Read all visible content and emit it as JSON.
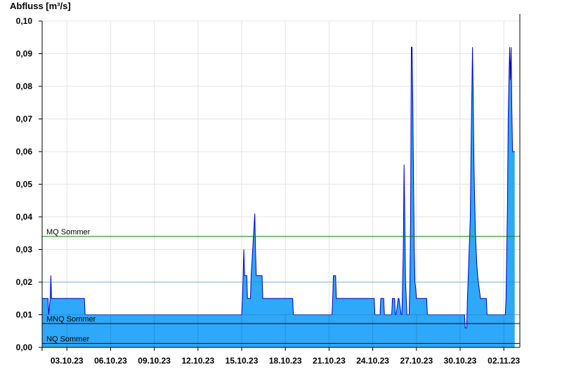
{
  "chart_data": {
    "type": "area",
    "ylabel": "Abfluss [m³/s]",
    "ylim": [
      0,
      0.1
    ],
    "y_ticks": [
      "0,00",
      "0,01",
      "0,02",
      "0,03",
      "0,04",
      "0,05",
      "0,06",
      "0,07",
      "0,08",
      "0,09",
      "0,10"
    ],
    "x_ticks": [
      "03.10.23",
      "06.10.23",
      "09.10.23",
      "12.10.23",
      "15.10.23",
      "18.10.23",
      "21.10.23",
      "24.10.23",
      "27.10.23",
      "30.10.23",
      "02.11.23"
    ],
    "x_tick_days": [
      2,
      5,
      8,
      11,
      14,
      17,
      20,
      23,
      26,
      29,
      32
    ],
    "xlim_days": [
      0.3,
      33.1
    ],
    "x_note": "x values in days since 01.10.23 00:00",
    "grid": true,
    "series": [
      {
        "name": "Abfluss",
        "color_fill": "#2ea8f8",
        "color_line": "#0000c8",
        "x": [
          0.3,
          0.7,
          0.75,
          0.85,
          0.9,
          0.95,
          1.0,
          1.05,
          1.1,
          1.15,
          1.2,
          3.2,
          3.25,
          14.0,
          14.05,
          14.1,
          14.15,
          14.2,
          14.35,
          14.4,
          14.6,
          14.65,
          14.9,
          14.95,
          15.0,
          15.05,
          15.1,
          15.15,
          15.4,
          15.45,
          17.5,
          17.55,
          20.2,
          20.25,
          20.3,
          20.45,
          20.5,
          23.1,
          23.15,
          23.5,
          23.55,
          23.6,
          23.75,
          23.8,
          24.3,
          24.35,
          24.5,
          24.55,
          24.6,
          24.75,
          24.8,
          24.95,
          25.0,
          25.1,
          25.15,
          25.2,
          25.25,
          25.3,
          25.35,
          25.4,
          25.5,
          25.55,
          25.6,
          25.65,
          25.7,
          25.75,
          25.8,
          25.85,
          25.9,
          25.95,
          26.0,
          26.1,
          26.2,
          26.3,
          26.4,
          26.5,
          26.55,
          26.7,
          26.75,
          29.3,
          29.35,
          29.45,
          29.5,
          29.7,
          29.75,
          29.85,
          29.9,
          29.95,
          30.0,
          30.05,
          30.1,
          30.15,
          30.25,
          30.4,
          30.5,
          30.8,
          30.85,
          32.1,
          32.15,
          32.25,
          32.3,
          32.35,
          32.4,
          32.45,
          32.5,
          32.55,
          32.6,
          32.7,
          32.75
        ],
        "y": [
          0.015,
          0.015,
          0.01,
          0.015,
          0.022,
          0.015,
          0.015,
          0.015,
          0.015,
          0.015,
          0.015,
          0.015,
          0.01,
          0.01,
          0.015,
          0.022,
          0.03,
          0.022,
          0.022,
          0.015,
          0.015,
          0.022,
          0.041,
          0.03,
          0.022,
          0.022,
          0.022,
          0.022,
          0.022,
          0.015,
          0.015,
          0.01,
          0.01,
          0.015,
          0.022,
          0.022,
          0.015,
          0.015,
          0.01,
          0.01,
          0.015,
          0.015,
          0.015,
          0.01,
          0.01,
          0.015,
          0.015,
          0.01,
          0.01,
          0.015,
          0.015,
          0.01,
          0.01,
          0.03,
          0.056,
          0.04,
          0.02,
          0.015,
          0.01,
          0.01,
          0.01,
          0.02,
          0.04,
          0.092,
          0.092,
          0.075,
          0.05,
          0.03,
          0.02,
          0.018,
          0.015,
          0.015,
          0.015,
          0.015,
          0.015,
          0.015,
          0.015,
          0.015,
          0.01,
          0.01,
          0.006,
          0.006,
          0.015,
          0.04,
          0.06,
          0.092,
          0.075,
          0.056,
          0.045,
          0.035,
          0.03,
          0.025,
          0.02,
          0.015,
          0.015,
          0.015,
          0.01,
          0.01,
          0.015,
          0.044,
          0.07,
          0.082,
          0.092,
          0.082,
          0.092,
          0.073,
          0.06,
          0.06,
          0.06
        ]
      }
    ],
    "reference_lines": [
      {
        "label": "MQ Sommer",
        "value": 0.034,
        "color": "#008000"
      },
      {
        "label": "MNQ Sommer",
        "value": 0.0073,
        "color": "#000000"
      },
      {
        "label": "NQ Sommer",
        "value": 0.0012,
        "color": "#000000"
      }
    ]
  },
  "colors": {
    "grid": "#e4e4e4",
    "grid_under_area": "#1f80c0",
    "axis": "#000000"
  }
}
